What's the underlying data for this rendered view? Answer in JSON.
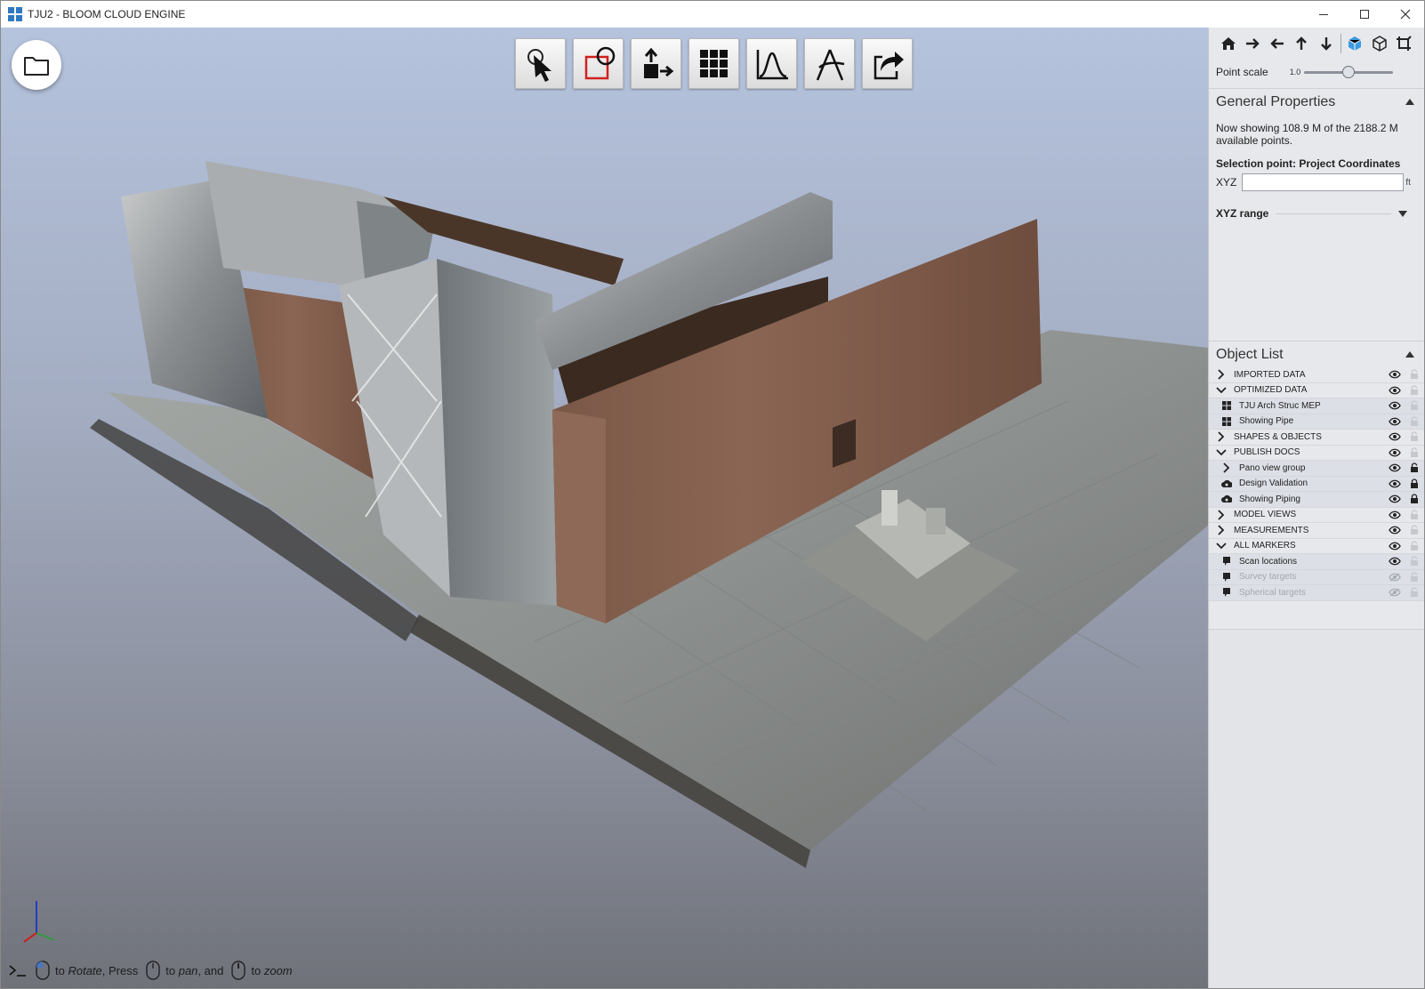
{
  "window": {
    "title": "TJU2 - BLOOM CLOUD ENGINE",
    "controls": [
      "minimize-icon",
      "maximize-icon",
      "close-icon"
    ]
  },
  "viewport": {
    "toolbar": [
      {
        "name": "select-tool",
        "icon": "cursor-arrow-icon"
      },
      {
        "name": "clip-box-tool",
        "icon": "clip-box-icon"
      },
      {
        "name": "export-points-tool",
        "icon": "export-box-icon"
      },
      {
        "name": "grid-view-tool",
        "icon": "grid-icon"
      },
      {
        "name": "profile-tool",
        "icon": "profile-curve-icon"
      },
      {
        "name": "measure-tool",
        "icon": "compass-icon"
      },
      {
        "name": "share-tool",
        "icon": "share-icon"
      }
    ],
    "open_icon": "folder-icon",
    "hint": {
      "part1": "to",
      "rotate": "Rotate",
      "part2": ", Press",
      "part3": "to",
      "pan": "pan",
      "part4": ", and",
      "part5": "to",
      "zoom": "zoom"
    }
  },
  "panel": {
    "nav_buttons": [
      "home-icon",
      "arrow-right-icon",
      "arrow-left-icon",
      "arrow-up-icon",
      "arrow-down-icon",
      "perspective-cube-icon",
      "orthographic-cube-icon",
      "crop-icon"
    ],
    "point_scale": {
      "label": "Point scale",
      "value_text": "1.0",
      "value": 1.0,
      "min": 0.0,
      "max": 2.0
    },
    "general_properties": {
      "title": "General Properties",
      "description": "Now showing 108.9 M of the 2188.2 M available points.",
      "selection_title": "Selection point: Project Coordinates",
      "xyz_label": "XYZ",
      "xyz_value": "",
      "xyz_unit": "ft",
      "range_label": "XYZ range"
    },
    "object_list": {
      "title": "Object List",
      "rows": [
        {
          "label": "IMPORTED DATA",
          "kind": "group",
          "expander": "chevron-right-icon",
          "visible": true,
          "lock": "unlocked-faint"
        },
        {
          "label": "OPTIMIZED DATA",
          "kind": "group",
          "expander": "chevron-down-icon",
          "visible": true,
          "lock": "unlocked-faint"
        },
        {
          "label": "TJU Arch Struc MEP",
          "kind": "child",
          "expander": "grid-icon",
          "visible": true,
          "lock": "unlocked-faint"
        },
        {
          "label": "Showing Pipe",
          "kind": "child",
          "expander": "grid-icon",
          "visible": true,
          "lock": "unlocked-faint"
        },
        {
          "label": "SHAPES & OBJECTS",
          "kind": "group",
          "expander": "chevron-right-icon",
          "visible": true,
          "lock": "unlocked-faint"
        },
        {
          "label": "PUBLISH DOCS",
          "kind": "group",
          "expander": "chevron-down-icon",
          "visible": true,
          "lock": "unlocked-faint"
        },
        {
          "label": "Pano view group",
          "kind": "child",
          "expander": "chevron-right-icon",
          "visible": true,
          "lock": "unlocked"
        },
        {
          "label": "Design Validation",
          "kind": "child",
          "expander": "cloud-icon",
          "visible": true,
          "lock": "locked"
        },
        {
          "label": "Showing Piping",
          "kind": "child",
          "expander": "cloud-icon",
          "visible": true,
          "lock": "locked"
        },
        {
          "label": "MODEL VIEWS",
          "kind": "group",
          "expander": "chevron-right-icon",
          "visible": true,
          "lock": "unlocked-faint"
        },
        {
          "label": "MEASUREMENTS",
          "kind": "group",
          "expander": "chevron-right-icon",
          "visible": true,
          "lock": "unlocked-faint"
        },
        {
          "label": "ALL MARKERS",
          "kind": "group",
          "expander": "chevron-down-icon",
          "visible": true,
          "lock": "unlocked-faint"
        },
        {
          "label": "Scan locations",
          "kind": "child",
          "expander": "marker-icon",
          "visible": true,
          "lock": "unlocked-faint"
        },
        {
          "label": "Survey targets",
          "kind": "child",
          "expander": "marker-icon",
          "visible": false,
          "lock": "unlocked-faint"
        },
        {
          "label": "Spherical targets",
          "kind": "child",
          "expander": "marker-icon",
          "visible": false,
          "lock": "unlocked-faint"
        }
      ]
    }
  }
}
